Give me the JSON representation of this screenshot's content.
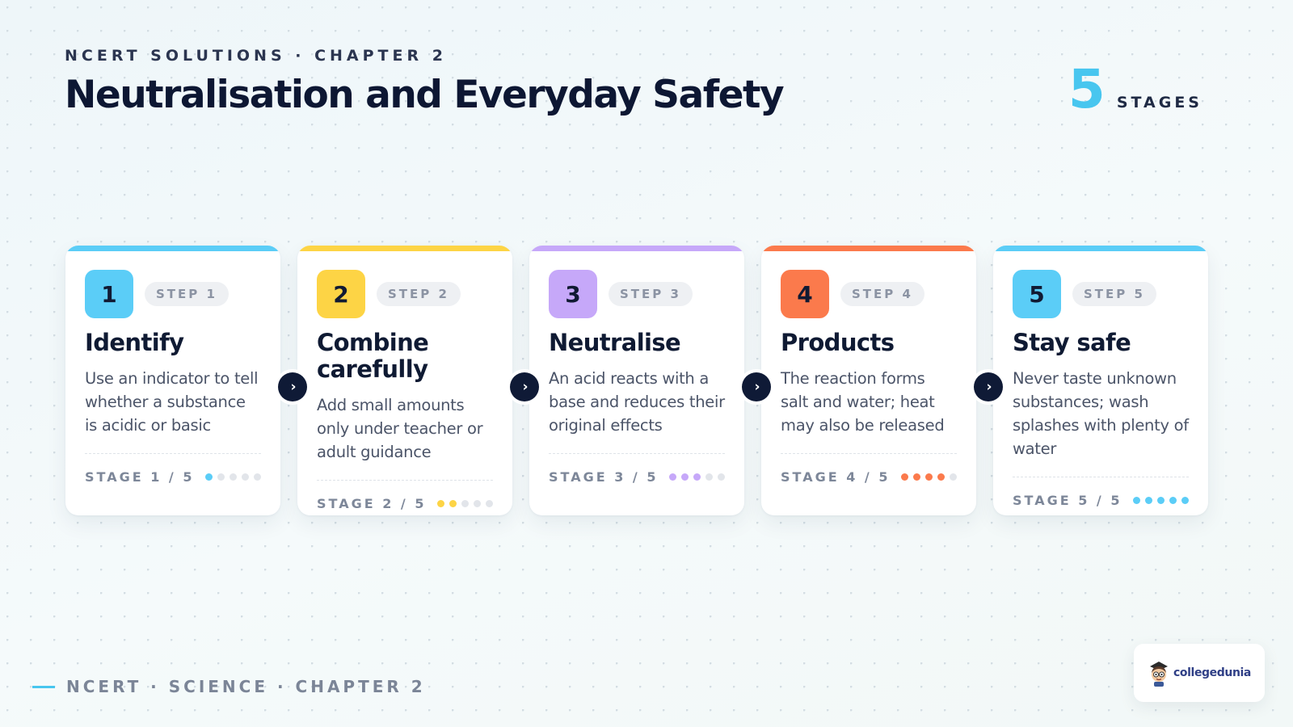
{
  "header": {
    "kicker": "NCERT SOLUTIONS · CHAPTER 2",
    "title": "Neutralisation and Everyday Safety",
    "stage_count": "5",
    "stage_count_label": "STAGES"
  },
  "accents": [
    "#5bcdf7",
    "#fdd445",
    "#c6a8f9",
    "#fb7a4c",
    "#5bcdf7"
  ],
  "stages": [
    {
      "number": "1",
      "step_label": "STEP 1",
      "title": "Identify",
      "description": "Use an indicator to tell whether a substance is acidic or basic",
      "stage_label": "STAGE 1 / 5",
      "progress": 1,
      "accent": "#5bcdf7"
    },
    {
      "number": "2",
      "step_label": "STEP 2",
      "title": "Combine carefully",
      "description": "Add small amounts only under teacher or adult guidance",
      "stage_label": "STAGE 2 / 5",
      "progress": 2,
      "accent": "#fdd445"
    },
    {
      "number": "3",
      "step_label": "STEP 3",
      "title": "Neutralise",
      "description": "An acid reacts with a base and reduces their original effects",
      "stage_label": "STAGE 3 / 5",
      "progress": 3,
      "accent": "#c6a8f9"
    },
    {
      "number": "4",
      "step_label": "STEP 4",
      "title": "Products",
      "description": "The reaction forms salt and water; heat may also be released",
      "stage_label": "STAGE 4 / 5",
      "progress": 4,
      "accent": "#fb7a4c"
    },
    {
      "number": "5",
      "step_label": "STEP 5",
      "title": "Stay safe",
      "description": "Never taste unknown substances; wash splashes with plenty of water",
      "stage_label": "STAGE 5 / 5",
      "progress": 5,
      "accent": "#5bcdf7"
    }
  ],
  "footer": {
    "text": "NCERT · SCIENCE · CHAPTER 2"
  },
  "brand": {
    "name": "collegedunia"
  },
  "icons": {
    "arrow": "chevron-right-icon",
    "logo": "collegedunia-mascot-icon"
  }
}
